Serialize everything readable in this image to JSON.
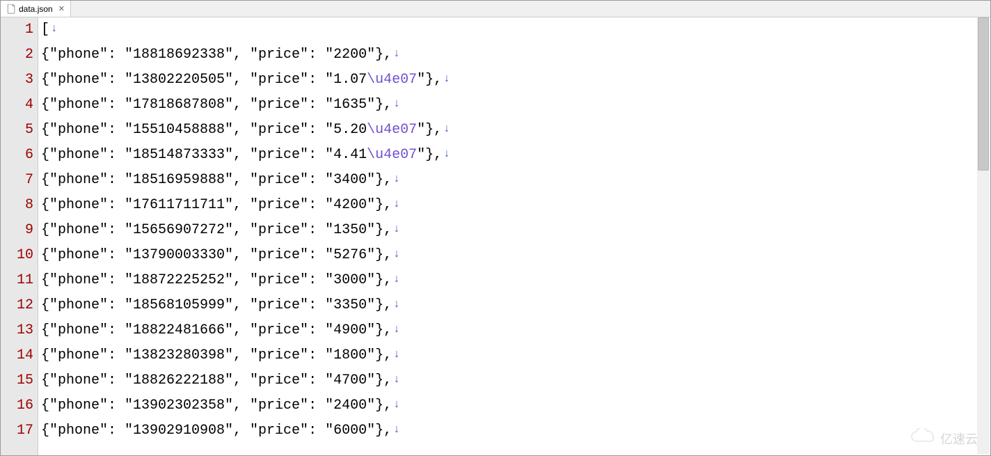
{
  "tab": {
    "filename": "data.json"
  },
  "escape_seq": "\\u4e07",
  "eol_arrow": "↓",
  "lines": [
    {
      "num": 1,
      "segments": [
        {
          "t": "["
        }
      ],
      "cursor_before_eol": true
    },
    {
      "num": 2,
      "segments": [
        {
          "t": "{\"phone\": \"18818692338\", \"price\": \"2200\"},"
        }
      ]
    },
    {
      "num": 3,
      "segments": [
        {
          "t": "{\"phone\": \"13802220505\", \"price\": \"1.07"
        },
        {
          "t": "\\u4e07",
          "esc": true
        },
        {
          "t": "\"},"
        }
      ]
    },
    {
      "num": 4,
      "segments": [
        {
          "t": "{\"phone\": \"17818687808\", \"price\": \"1635\"},"
        }
      ]
    },
    {
      "num": 5,
      "segments": [
        {
          "t": "{\"phone\": \"15510458888\", \"price\": \"5.20"
        },
        {
          "t": "\\u4e07",
          "esc": true
        },
        {
          "t": "\"},"
        }
      ]
    },
    {
      "num": 6,
      "segments": [
        {
          "t": "{\"phone\": \"18514873333\", \"price\": \"4.41"
        },
        {
          "t": "\\u4e07",
          "esc": true
        },
        {
          "t": "\"},"
        }
      ]
    },
    {
      "num": 7,
      "segments": [
        {
          "t": "{\"phone\": \"18516959888\", \"price\": \"3400\"},"
        }
      ]
    },
    {
      "num": 8,
      "segments": [
        {
          "t": "{\"phone\": \"17611711711\", \"price\": \"4200\"},"
        }
      ]
    },
    {
      "num": 9,
      "segments": [
        {
          "t": "{\"phone\": \"15656907272\", \"price\": \"1350\"},"
        }
      ]
    },
    {
      "num": 10,
      "segments": [
        {
          "t": "{\"phone\": \"13790003330\", \"price\": \"5276\"},"
        }
      ]
    },
    {
      "num": 11,
      "segments": [
        {
          "t": "{\"phone\": \"18872225252\", \"price\": \"3000\"},"
        }
      ]
    },
    {
      "num": 12,
      "segments": [
        {
          "t": "{\"phone\": \"18568105999\", \"price\": \"3350\"},"
        }
      ]
    },
    {
      "num": 13,
      "segments": [
        {
          "t": "{\"phone\": \"18822481666\", \"price\": \"4900\"},"
        }
      ]
    },
    {
      "num": 14,
      "segments": [
        {
          "t": "{\"phone\": \"13823280398\", \"price\": \"1800\"},"
        }
      ]
    },
    {
      "num": 15,
      "segments": [
        {
          "t": "{\"phone\": \"18826222188\", \"price\": \"4700\"},"
        }
      ]
    },
    {
      "num": 16,
      "segments": [
        {
          "t": "{\"phone\": \"13902302358\", \"price\": \"2400\"},"
        }
      ]
    },
    {
      "num": 17,
      "segments": [
        {
          "t": "{\"phone\": \"13902910908\", \"price\": \"6000\"},"
        }
      ]
    }
  ],
  "watermark": "亿速云"
}
